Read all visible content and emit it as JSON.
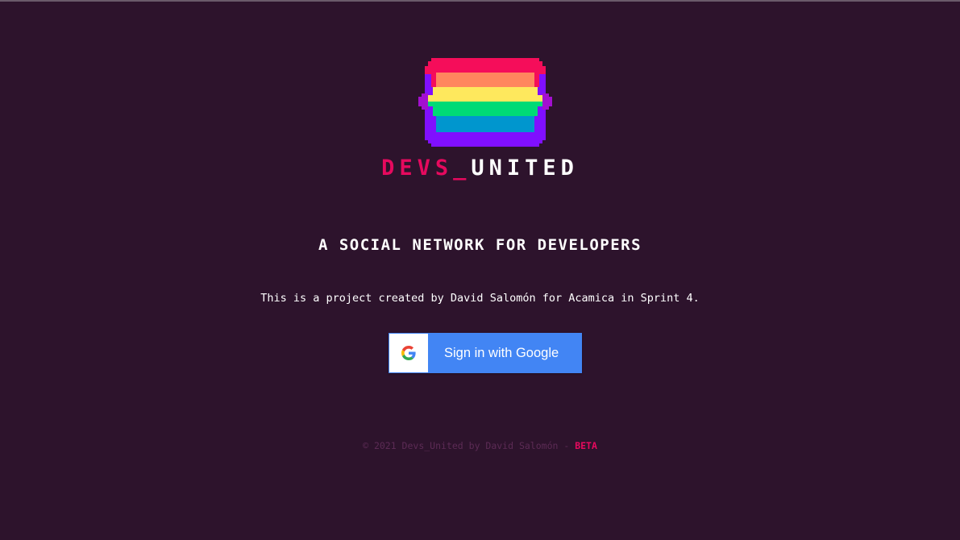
{
  "brand": {
    "name_part1": "DEVS_",
    "name_part2": "UNITED",
    "accent_color": "#e6095e",
    "background_color": "#2d132c"
  },
  "logo": {
    "icon": "rainbow-pixel-logo-icon",
    "stripe_colors": [
      "#f50d5a",
      "#ff865e",
      "#fee85d",
      "#00da76",
      "#0096ce",
      "#800fff"
    ]
  },
  "tagline": "A SOCIAL NETWORK FOR DEVELOPERS",
  "description": "This is a project created by David Salomón for Acamica in Sprint 4.",
  "signin": {
    "label": "Sign in with Google",
    "icon": "google-g-icon",
    "button_color": "#4285f4"
  },
  "footer": {
    "copyright": "© 2021 Devs_United by David Salomón - ",
    "badge": "BETA"
  }
}
